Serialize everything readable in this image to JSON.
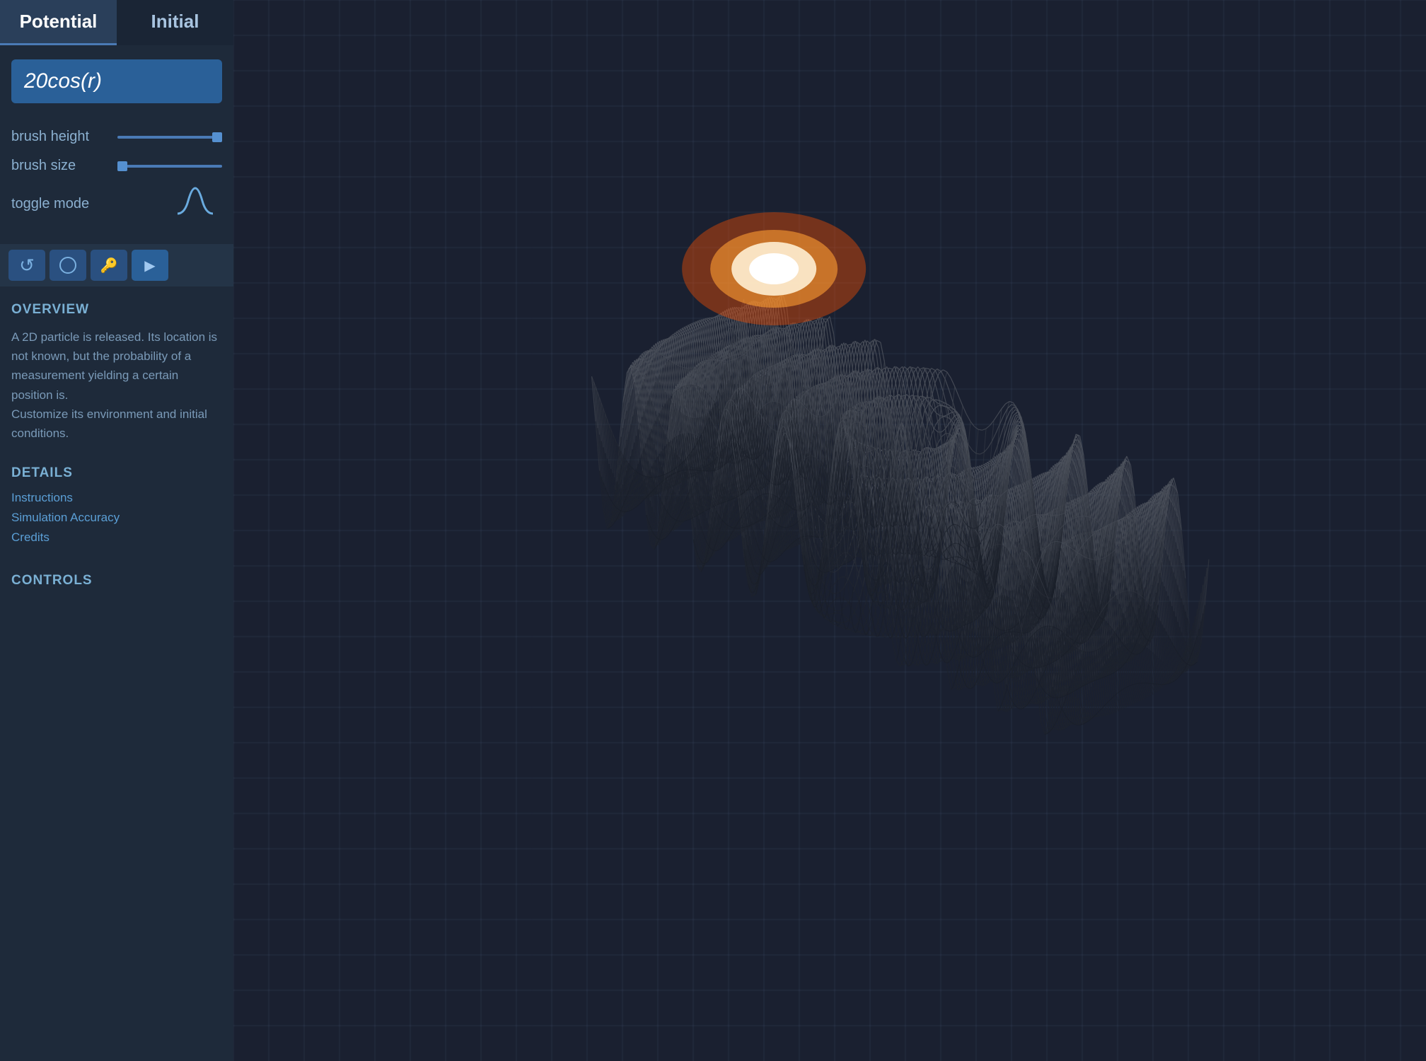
{
  "tabs": [
    {
      "id": "potential",
      "label": "Potential",
      "active": true
    },
    {
      "id": "initial",
      "label": "Initial",
      "active": false
    }
  ],
  "formula": {
    "value": "20cos(r)"
  },
  "controls": {
    "brush_height": {
      "label": "brush height",
      "value": 100,
      "min": 0,
      "max": 100
    },
    "brush_size": {
      "label": "brush size",
      "value": 5,
      "min": 0,
      "max": 100
    },
    "toggle_mode": {
      "label": "toggle mode"
    }
  },
  "toolbar": {
    "buttons": [
      {
        "id": "undo",
        "icon": "↺",
        "label": "undo"
      },
      {
        "id": "circle",
        "icon": "○",
        "label": "circle-tool"
      },
      {
        "id": "key",
        "icon": "🔑",
        "label": "key-tool"
      },
      {
        "id": "play",
        "icon": "▶",
        "label": "play"
      }
    ]
  },
  "overview": {
    "title": "OVERVIEW",
    "text": "A 2D particle is released.  Its location is not known, but the probability of a measurement yielding a certain position is.\nCustomize its environment and initial conditions."
  },
  "details": {
    "title": "DETAILS",
    "links": [
      {
        "label": "Instructions"
      },
      {
        "label": "Simulation Accuracy"
      },
      {
        "label": "Credits"
      }
    ]
  },
  "controls_section": {
    "title": "CONTROLS"
  },
  "colors": {
    "accent": "#4a7ab5",
    "tab_active_bg": "#2a3f5a",
    "formula_bg": "#2a6098",
    "sidebar_bg": "#1e2a3a",
    "toolbar_bg": "#243447"
  }
}
